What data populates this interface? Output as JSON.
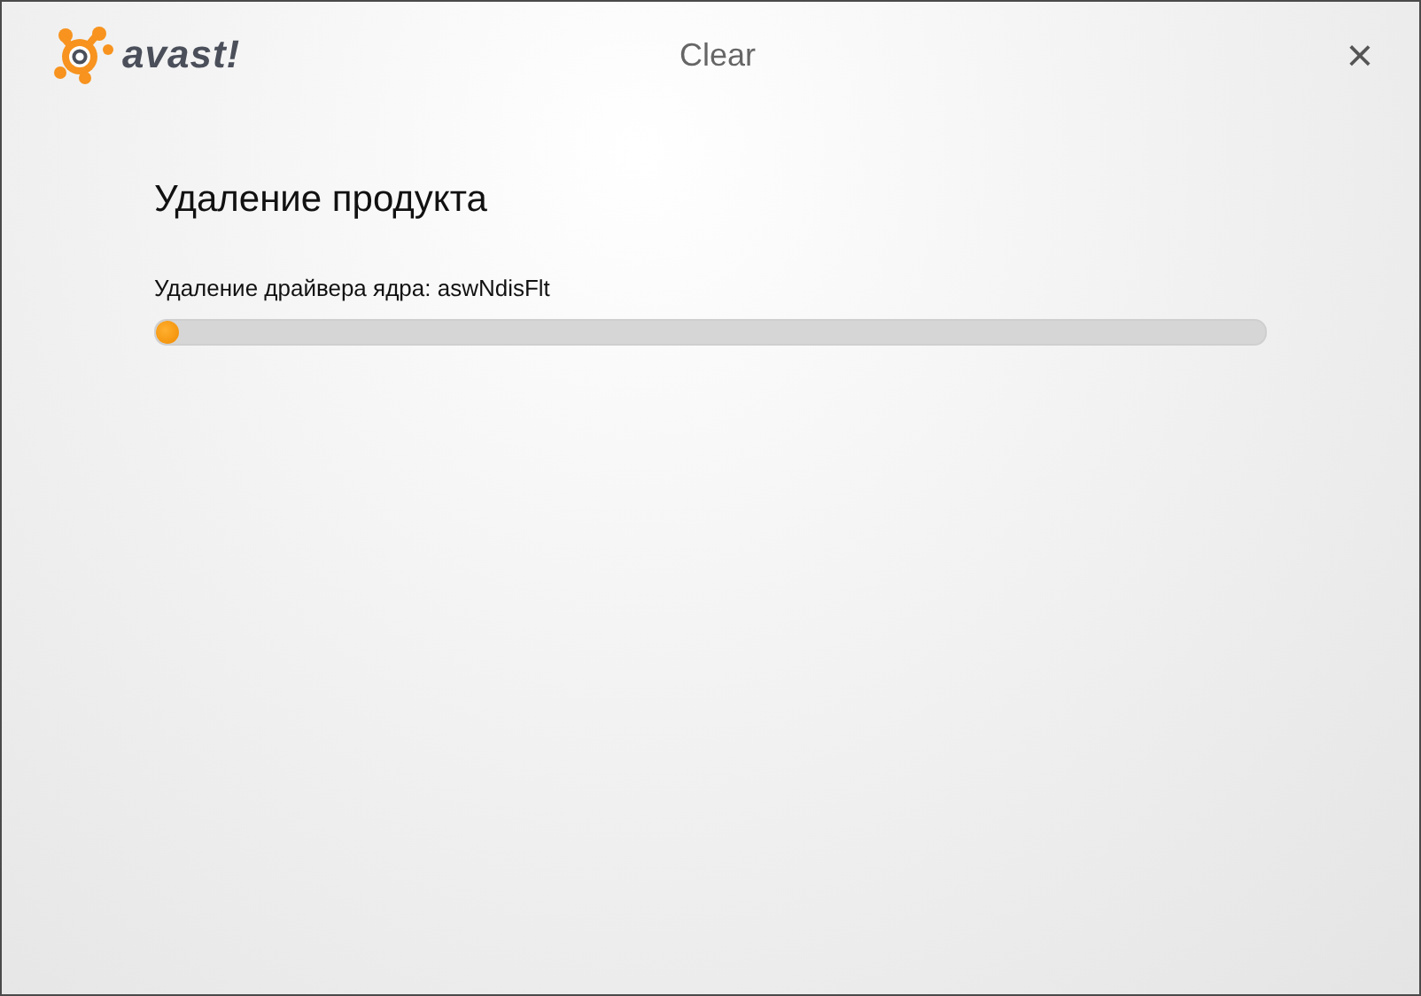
{
  "logo": {
    "text": "avast!"
  },
  "window": {
    "title": "Clear",
    "close": "×"
  },
  "heading": "Удаление продукта",
  "progress": {
    "label": "Удаление драйвера ядра: aswNdisFlt",
    "level": 0.02
  }
}
